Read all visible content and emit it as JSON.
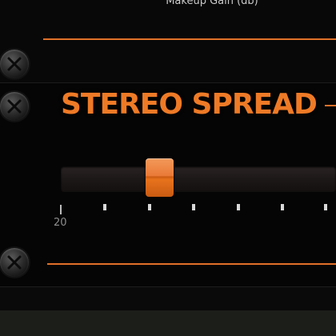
{
  "header": {
    "label": "Makeup Gain (db)"
  },
  "section": {
    "title": "STEREO SPREAD"
  },
  "slider": {
    "value_fraction": 0.32,
    "tick_label_first": "20"
  },
  "colors": {
    "accent": "#e07028",
    "title": "#ee7a26",
    "background": "#060606"
  },
  "icons": {
    "screw": "screw-icon"
  }
}
